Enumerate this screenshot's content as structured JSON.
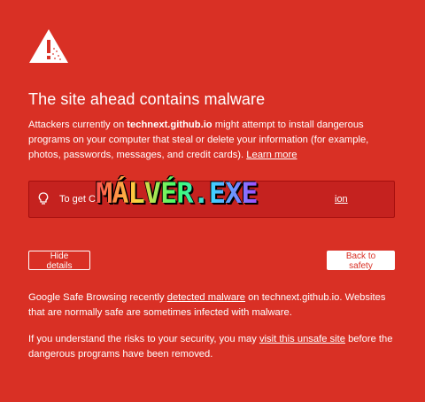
{
  "theme": {
    "background": "#d93025",
    "accent_dark": "#c5221f"
  },
  "icons": {
    "warning": "warning-triangle-icon",
    "tip": "lightbulb-icon"
  },
  "headline": "The site ahead contains malware",
  "intro": {
    "prefix": "Attackers currently on ",
    "site": "technext.github.io",
    "suffix": " might attempt to install dangerous programs on your computer that steal or delete your information (for example, photos, passwords, messages, and credit cards). ",
    "learn_more": "Learn more"
  },
  "tip": {
    "text": "To get Ch",
    "link": "ion"
  },
  "overlay_text": "MÁLVÉR.EXE",
  "buttons": {
    "hide_details": "Hide details",
    "back_to_safety": "Back to safety"
  },
  "details": {
    "p1_prefix": "Google Safe Browsing recently ",
    "p1_link": "detected malware",
    "p1_suffix": " on technext.github.io. Websites that are normally safe are sometimes infected with malware.",
    "p2_prefix": "If you understand the risks to your security, you may ",
    "p2_link": "visit this unsafe site",
    "p2_suffix": " before the dangerous programs have been removed."
  }
}
